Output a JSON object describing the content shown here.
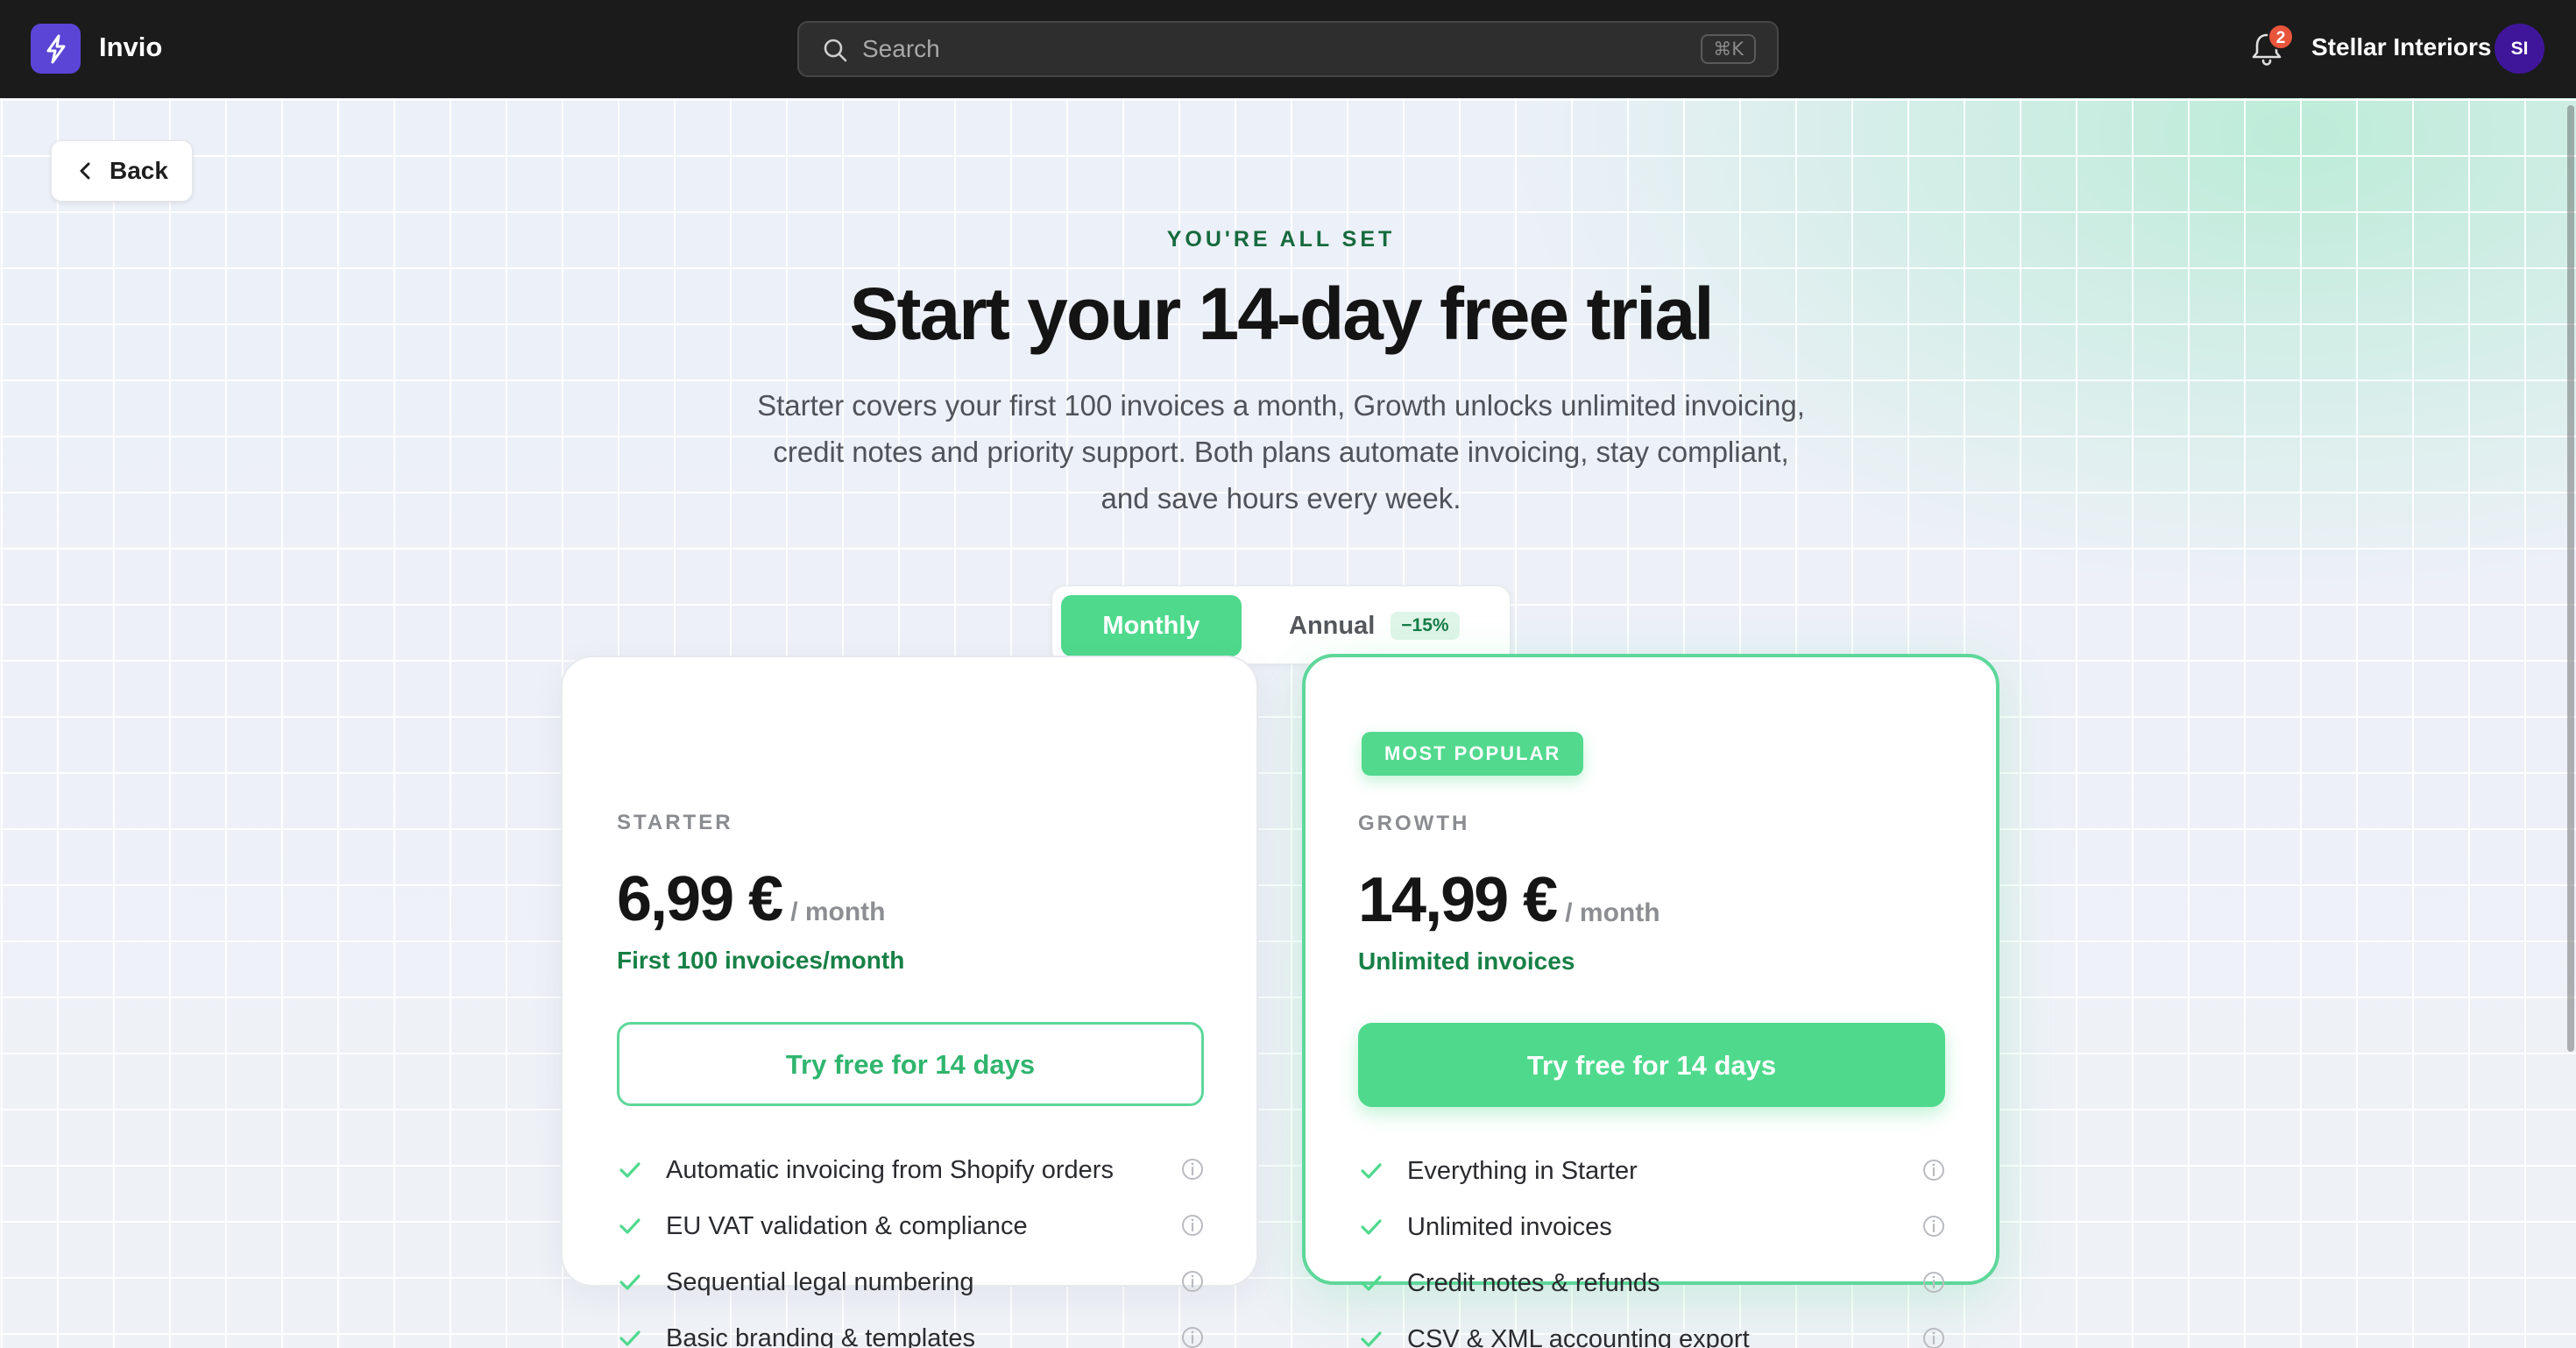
{
  "app": {
    "name": "Invio",
    "search_placeholder": "Search",
    "search_shortcut": "⌘K",
    "notification_count": "2",
    "org_name": "Stellar Interiors",
    "avatar_initials": "SI"
  },
  "nav": {
    "back_label": "Back"
  },
  "hero": {
    "eyebrow": "YOU'RE ALL SET",
    "title": "Start your 14-day free trial",
    "subtitle": "Starter covers your first 100 invoices a month, Growth unlocks unlimited invoicing, credit notes and priority support. Both plans automate invoicing, stay compliant, and save hours every week."
  },
  "billing_toggle": {
    "monthly_label": "Monthly",
    "annual_label": "Annual",
    "annual_discount": "−15%",
    "selected": "Monthly"
  },
  "plans": [
    {
      "name": "STARTER",
      "price": "6,99 €",
      "period": "/ month",
      "quota": "First 100 invoices/month",
      "cta": "Try free for 14 days",
      "features": [
        "Automatic invoicing from Shopify orders",
        "EU VAT validation & compliance",
        "Sequential legal numbering",
        "Basic branding & templates"
      ]
    },
    {
      "name": "GROWTH",
      "badge": "MOST POPULAR",
      "price": "14,99 €",
      "period": "/ month",
      "quota": "Unlimited invoices",
      "cta": "Try free for 14 days",
      "features": [
        "Everything in Starter",
        "Unlimited invoices",
        "Credit notes & refunds",
        "CSV & XML accounting export"
      ]
    }
  ],
  "colors": {
    "topbar": "#1b1b1b",
    "accent_green": "#4fd98d",
    "text_green": "#178046",
    "brand_purple": "#5b45d6",
    "avatar_purple": "#3f169a",
    "badge_red": "#e8553b"
  },
  "icons": {
    "logo": "lightning-logo-icon",
    "search": "search-icon",
    "notifications": "bell-icon",
    "back": "chevron-left-icon",
    "feature_check": "check-icon",
    "feature_info": "info-icon"
  }
}
